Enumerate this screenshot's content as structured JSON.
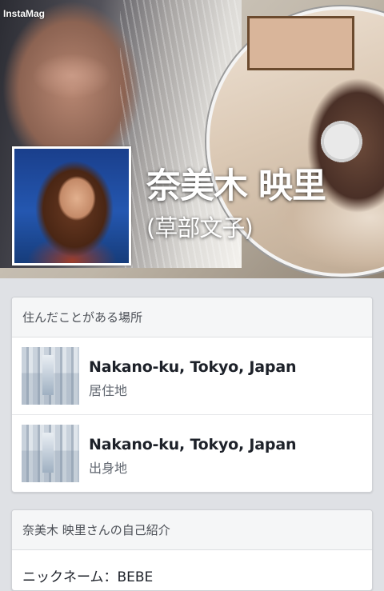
{
  "cover": {
    "watermark": "InstaMag"
  },
  "profile": {
    "name": "奈美木 映里",
    "alt_name": "(草部文子)"
  },
  "places": {
    "header": "住んだことがある場所",
    "items": [
      {
        "name": "Nakano-ku, Tokyo, Japan",
        "type": "居住地"
      },
      {
        "name": "Nakano-ku, Tokyo, Japan",
        "type": "出身地"
      }
    ]
  },
  "intro": {
    "header": "奈美木 映里さんの自己紹介",
    "first_line": "ニックネーム：BEBE"
  }
}
